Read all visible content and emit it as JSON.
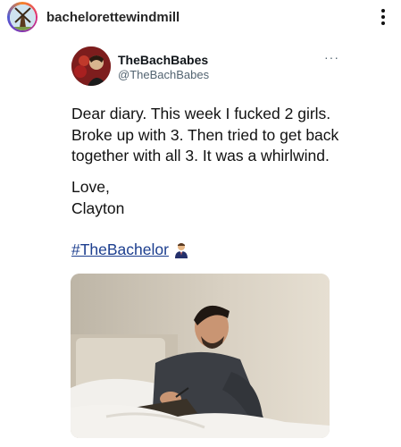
{
  "post": {
    "username": "bachelorettewindmill"
  },
  "tweet": {
    "display_name": "TheBachBabes",
    "handle": "@TheBachBabes",
    "more": "···",
    "body": "Dear diary. This week I fucked 2 girls. Broke up with 3. Then tried to get back together with all 3. It was a whirlwind.",
    "sign_line_1": "Love,",
    "sign_line_2": "Clayton",
    "hashtag": "#TheBachelor"
  },
  "icons": {
    "post_avatar": "windmill-icon",
    "post_menu": "vertical-dots-icon",
    "hashtag_emoji": "man-in-suit-emoji"
  },
  "colors": {
    "hashtag": "#1d3f8f",
    "handle": "#536471"
  }
}
